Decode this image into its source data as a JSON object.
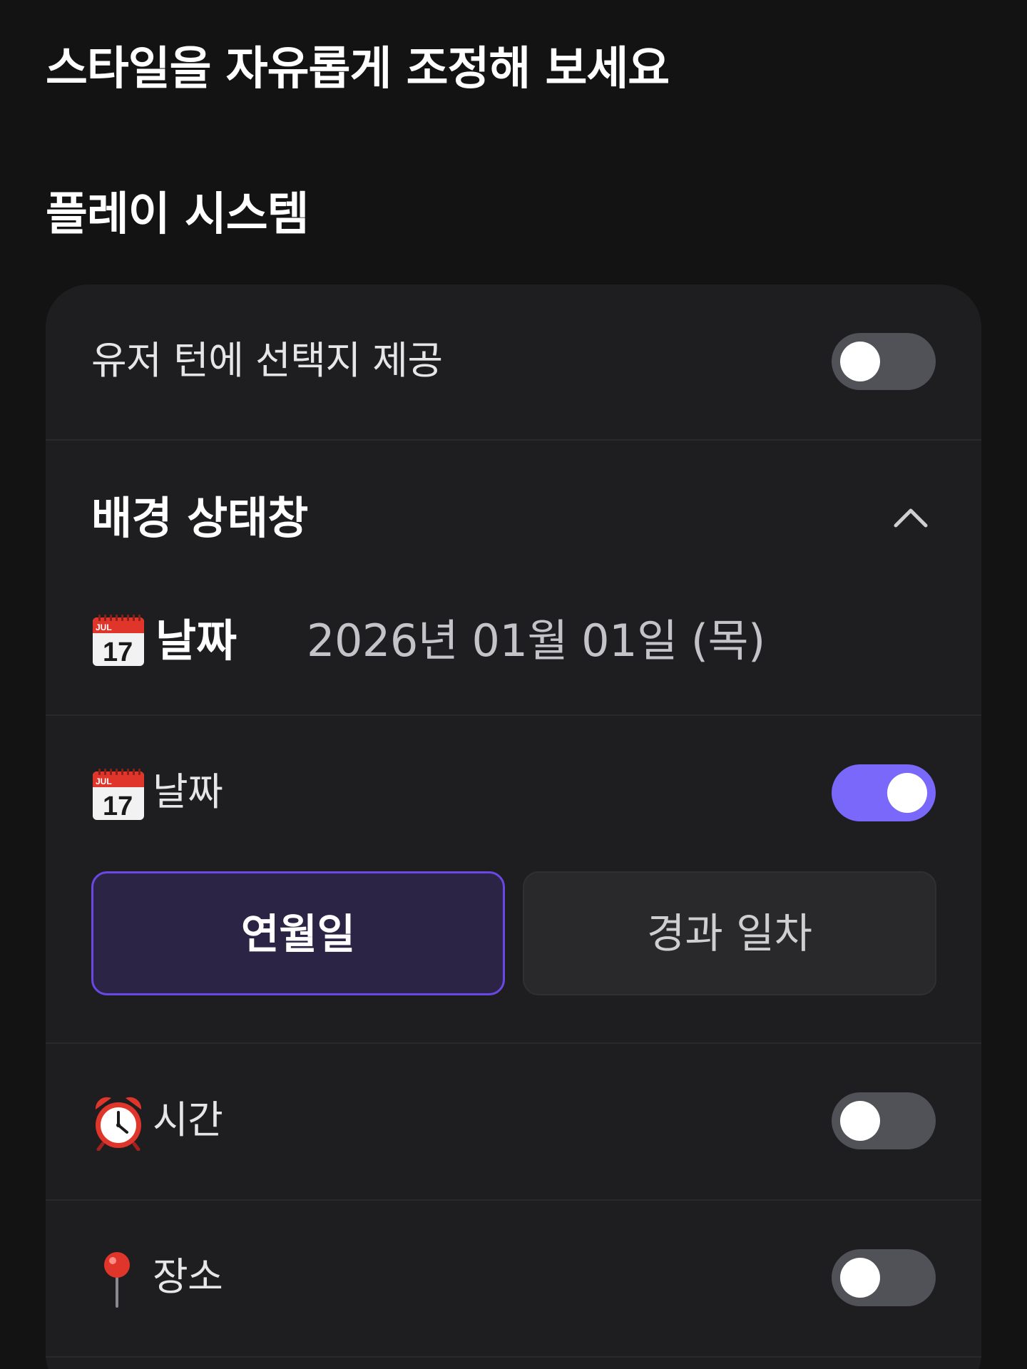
{
  "header": {
    "title": "스타일을 자유롭게 조정해 보세요",
    "section_title": "플레이 시스템"
  },
  "card": {
    "user_choices": {
      "label": "유저 턴에 선택지 제공",
      "enabled": false
    },
    "status_bar": {
      "title": "배경 상태창",
      "expanded": true,
      "summary_label": "날짜",
      "summary_value": "2026년 01월 01일 (목)"
    },
    "date": {
      "label": "날짜",
      "enabled": true,
      "options": [
        "연월일",
        "경과 일차"
      ],
      "selected_option": "연월일"
    },
    "time": {
      "label": "시간",
      "enabled": false
    },
    "place": {
      "label": "장소",
      "enabled": false
    }
  },
  "colors": {
    "background": "#131314",
    "card": "#1e1e20",
    "toggle_on": "#7a68fb",
    "toggle_off": "#515257",
    "segment_selected_border": "#6a48e6",
    "segment_selected_bg": "#2c2445"
  },
  "icons": {
    "calendar": "calendar-icon",
    "alarm_clock": "alarm-clock-icon",
    "pushpin": "round-pushpin-icon",
    "chevron": "chevron-up-icon"
  }
}
